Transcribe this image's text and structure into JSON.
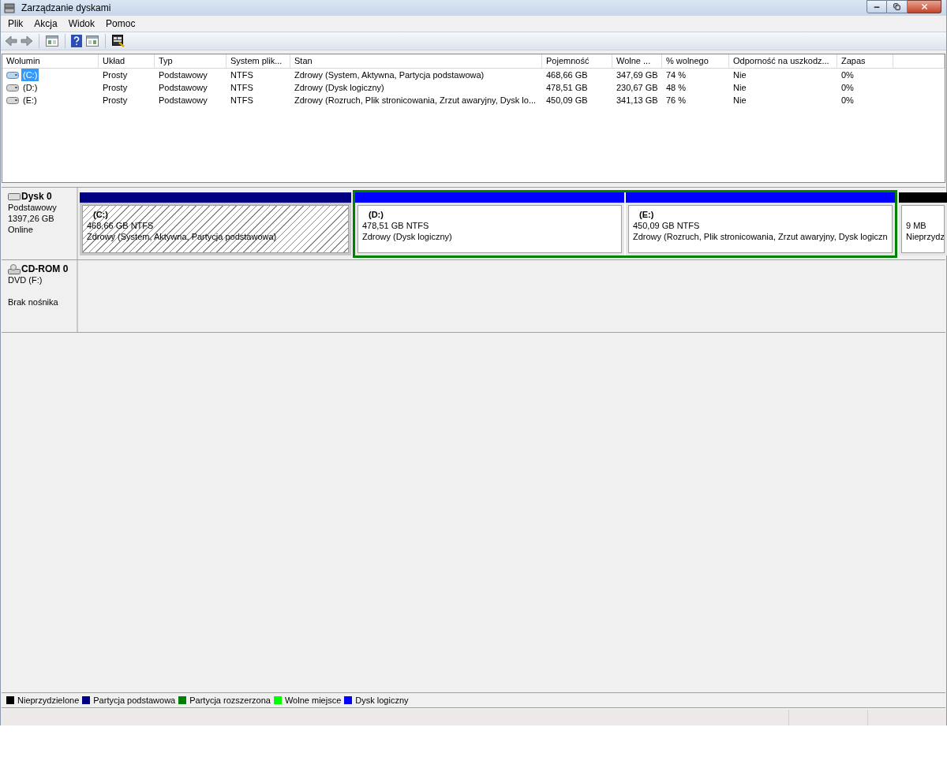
{
  "window": {
    "title": "Zarządzanie dyskami"
  },
  "menu": [
    {
      "label": "Plik"
    },
    {
      "label": "Akcja"
    },
    {
      "label": "Widok"
    },
    {
      "label": "Pomoc"
    }
  ],
  "toolbar": [
    {
      "kind": "back"
    },
    {
      "kind": "forward"
    },
    {
      "kind": "separator"
    },
    {
      "kind": "tree"
    },
    {
      "kind": "separator"
    },
    {
      "kind": "help"
    },
    {
      "kind": "panel"
    },
    {
      "kind": "separator"
    },
    {
      "kind": "properties"
    }
  ],
  "table": {
    "columns": [
      "Wolumin",
      "Układ",
      "Typ",
      "System plik...",
      "Stan",
      "Pojemność",
      "Wolne ...",
      "% wolnego",
      "Odporność na uszkodz...",
      "Zapas"
    ],
    "rows": [
      {
        "selected": true,
        "cells": [
          "(C:)",
          "Prosty",
          "Podstawowy",
          "NTFS",
          "Zdrowy (System, Aktywna, Partycja podstawowa)",
          "468,66 GB",
          "347,69 GB",
          "74 %",
          "Nie",
          "0%"
        ]
      },
      {
        "selected": false,
        "cells": [
          "(D:)",
          "Prosty",
          "Podstawowy",
          "NTFS",
          "Zdrowy (Dysk logiczny)",
          "478,51 GB",
          "230,67 GB",
          "48 %",
          "Nie",
          "0%"
        ]
      },
      {
        "selected": false,
        "cells": [
          "(E:)",
          "Prosty",
          "Podstawowy",
          "NTFS",
          "Zdrowy (Rozruch, Plik stronicowania, Zrzut awaryjny, Dysk lo...",
          "450,09 GB",
          "341,13 GB",
          "76 %",
          "Nie",
          "0%"
        ]
      }
    ]
  },
  "disks": [
    {
      "kind": "disk",
      "name": "Dysk 0",
      "lines": [
        "Podstawowy",
        "1397,26 GB",
        "Online"
      ],
      "partitions": [
        {
          "kind": "primary",
          "selected": true,
          "name": "(C:)",
          "size": "468,66 GB NTFS",
          "status": "Zdrowy (System, Aktywna, Partycja podstawowa)"
        },
        {
          "kind": "extended",
          "children": [
            {
              "kind": "logical",
              "selected": false,
              "name": "(D:)",
              "size": "478,51 GB NTFS",
              "status": "Zdrowy (Dysk logiczny)"
            },
            {
              "kind": "logical",
              "selected": false,
              "name": "(E:)",
              "size": "450,09 GB NTFS",
              "status": "Zdrowy (Rozruch, Plik stronicowania, Zrzut awaryjny, Dysk logiczn"
            }
          ]
        },
        {
          "kind": "unallocated",
          "selected": false,
          "size": "9 MB",
          "status": "Nieprzydz"
        }
      ]
    },
    {
      "kind": "cdrom",
      "name": "CD-ROM 0",
      "lines": [
        "DVD (F:)"
      ],
      "media": "Brak nośnika"
    }
  ],
  "legend": [
    {
      "label": "Nieprzydzielone",
      "color": "#000000"
    },
    {
      "label": "Partycja podstawowa",
      "color": "#000080"
    },
    {
      "label": "Partycja rozszerzona",
      "color": "#008000"
    },
    {
      "label": "Wolne miejsce",
      "color": "#00ff00"
    },
    {
      "label": "Dysk logiczny",
      "color": "#0000ff"
    }
  ]
}
